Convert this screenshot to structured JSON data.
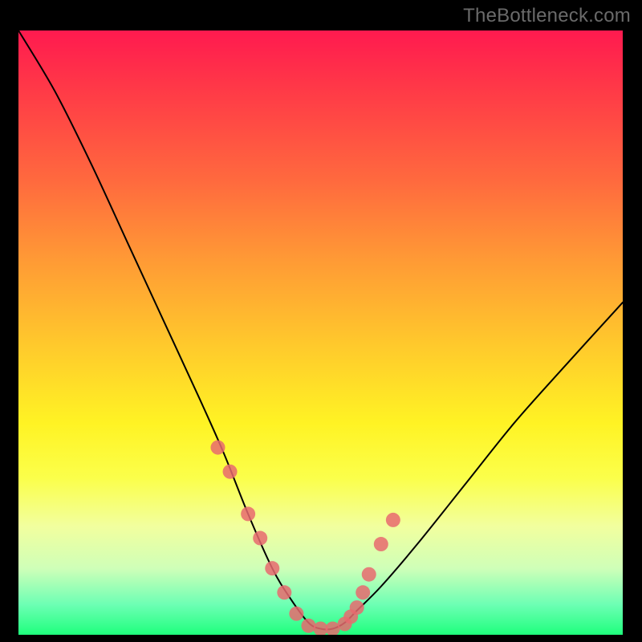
{
  "attribution": "TheBottleneck.com",
  "chart_data": {
    "type": "line",
    "title": "",
    "xlabel": "",
    "ylabel": "",
    "xlim": [
      0,
      100
    ],
    "ylim": [
      0,
      100
    ],
    "curve": {
      "name": "bottleneck-curve",
      "color": "#000000",
      "x": [
        0,
        6,
        12,
        18,
        24,
        30,
        34,
        38,
        42,
        45,
        48,
        50,
        52,
        54,
        56,
        60,
        66,
        74,
        82,
        90,
        100
      ],
      "y": [
        100,
        90,
        78,
        65,
        52,
        39,
        30,
        20,
        11,
        6,
        2,
        1,
        1,
        2,
        4,
        8,
        15,
        25,
        35,
        44,
        55
      ]
    },
    "markers": {
      "name": "bottleneck-points",
      "color": "#e86a6f",
      "radius_px": 9,
      "x": [
        33,
        35,
        38,
        40,
        42,
        44,
        46,
        48,
        50,
        52,
        54,
        55,
        56,
        57,
        58,
        60,
        62
      ],
      "y": [
        31,
        27,
        20,
        16,
        11,
        7,
        3.5,
        1.5,
        1,
        1,
        1.8,
        3,
        4.5,
        7,
        10,
        15,
        19
      ]
    }
  }
}
